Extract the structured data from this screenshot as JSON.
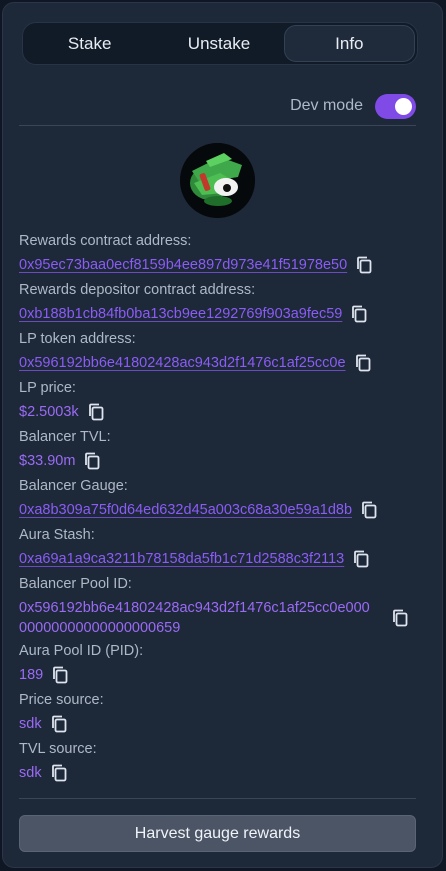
{
  "tabs": [
    {
      "label": "Stake",
      "active": false
    },
    {
      "label": "Unstake",
      "active": false
    },
    {
      "label": "Info",
      "active": true
    }
  ],
  "dev_mode": {
    "label": "Dev mode",
    "enabled": true
  },
  "fields": {
    "rewards_contract": {
      "label": "Rewards contract address:",
      "value": "0x95ec73baa0ecf8159b4ee897d973e41f51978e50"
    },
    "rewards_depositor": {
      "label": "Rewards depositor contract address:",
      "value": "0xb188b1cb84fb0ba13cb9ee1292769f903a9fec59"
    },
    "lp_token": {
      "label": "LP token address:",
      "value": "0x596192bb6e41802428ac943d2f1476c1af25cc0e"
    },
    "lp_price": {
      "label": "LP price:",
      "value": "$2.5003k"
    },
    "balancer_tvl": {
      "label": "Balancer TVL:",
      "value": "$33.90m"
    },
    "balancer_gauge": {
      "label": "Balancer Gauge:",
      "value": "0xa8b309a75f0d64ed632d45a003c68a30e59a1d8b"
    },
    "aura_stash": {
      "label": "Aura Stash:",
      "value": "0xa69a1a9ca3211b78158da5fb1c71d2588c3f2113"
    },
    "balancer_pool_id": {
      "label": "Balancer Pool ID:",
      "value_line1": "0x596192bb6e41802428ac943d2f1476c1af25cc0e000",
      "value_line2": "00000000000000000659"
    },
    "aura_pool_id": {
      "label": "Aura Pool ID (PID):",
      "value": "189"
    },
    "price_source": {
      "label": "Price source:",
      "value": "sdk"
    },
    "tvl_source": {
      "label": "TVL source:",
      "value": "sdk"
    }
  },
  "harvest_button": {
    "label": "Harvest gauge rewards"
  },
  "icons": {
    "copy": "copy-icon",
    "avatar": "pepe-token-avatar"
  },
  "colors": {
    "accent": "#8b5cf6",
    "toggle": "#7f4ae6",
    "panel": "#1d2839",
    "button": "#4b5566"
  }
}
